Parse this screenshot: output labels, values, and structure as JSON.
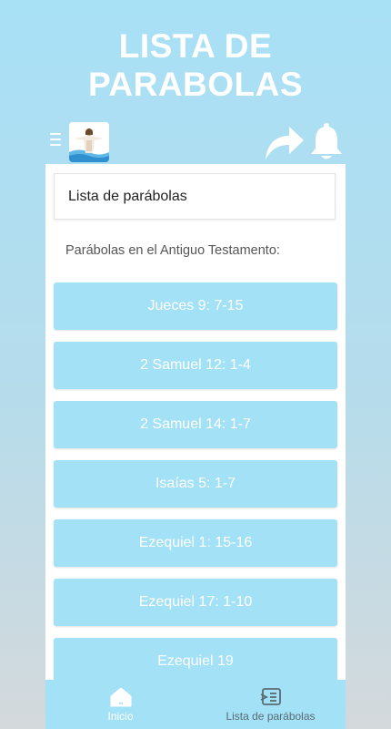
{
  "promo": {
    "title_line1": "LISTA DE",
    "title_line2": "PARABOLAS"
  },
  "app_bar": {
    "menu_icon": "hamburger-icon",
    "logo": "jesus-figure-logo",
    "share_icon": "share-arrow-icon",
    "bell_icon": "bell-icon"
  },
  "header": {
    "title": "Lista de parábolas"
  },
  "section": {
    "label": "Parábolas en el Antiguo Testamento:"
  },
  "references": [
    "Jueces 9: 7-15",
    "2 Samuel 12: 1-4",
    "2 Samuel 14: 1-7",
    "Isaías 5: 1-7",
    "Ezequiel 1: 15-16",
    "Ezequiel 17: 1-10",
    "Ezequiel 19"
  ],
  "bottom_nav": {
    "items": [
      {
        "label": "Inicio",
        "icon": "home-icon",
        "active": true
      },
      {
        "label": "Lista de parábolas",
        "icon": "list-icon",
        "active": false
      }
    ]
  },
  "colors": {
    "accent": "#a3e1f7",
    "background_top": "#a8e0f6",
    "background_bottom": "#d4d9dc",
    "text_dark": "#222222",
    "text_muted": "#555555"
  }
}
